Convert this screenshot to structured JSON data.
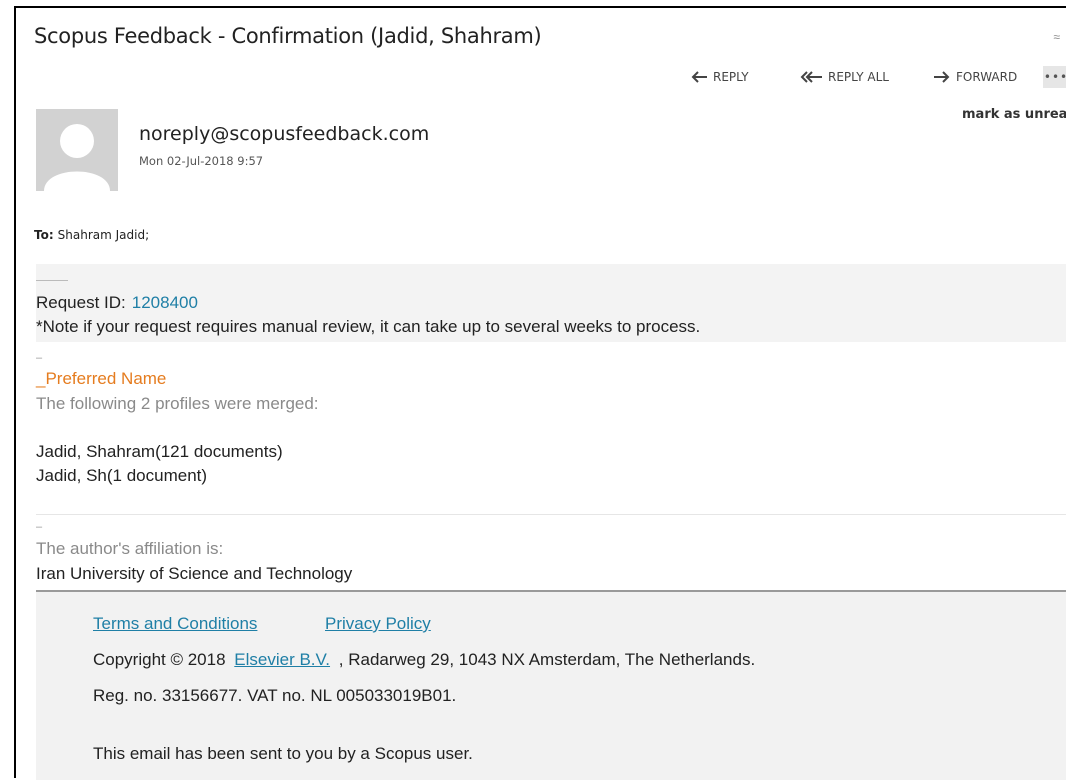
{
  "email": {
    "subject": "Scopus Feedback - Confirmation (Jadid, Shahram)",
    "sender": "noreply@scopusfeedback.com",
    "date": "Mon 02-Jul-2018 9:57",
    "to_label": "To:",
    "to_value": "Shahram Jadid;",
    "mark_unread": "mark as unread"
  },
  "actions": {
    "reply": "REPLY",
    "reply_all": "REPLY ALL",
    "forward": "FORWARD",
    "more": "•••",
    "collapse": "≈"
  },
  "body": {
    "request_label": "Request ID:",
    "request_id": "1208400",
    "note": "*Note if your request requires manual review, it can take up to several weeks to process.",
    "dash1": "–",
    "preferred_name": "_Preferred Name",
    "merge_note": "The following 2 profiles were merged:",
    "profiles": [
      "Jadid, Shahram(121 documents)",
      "Jadid, Sh(1 document)"
    ],
    "dash2": "–",
    "affiliation_label": "The author's affiliation is:",
    "affiliation_value": "Iran University of Science and Technology"
  },
  "footer": {
    "terms": "Terms and Conditions",
    "privacy": "Privacy Policy",
    "copyright_pre": "Copyright © 2018",
    "elsevier": "Elsevier B.V.",
    "copyright_post": ", Radarweg 29, 1043 NX Amsterdam, The Netherlands.",
    "reg": "Reg. no. 33156677. VAT no. NL 005033019B01.",
    "sent_by": "This email has been sent to you by a Scopus user."
  },
  "colors": {
    "link": "#1f7fa6",
    "accent_orange": "#e57c1f",
    "avatar_bg": "#d2d2d2"
  }
}
